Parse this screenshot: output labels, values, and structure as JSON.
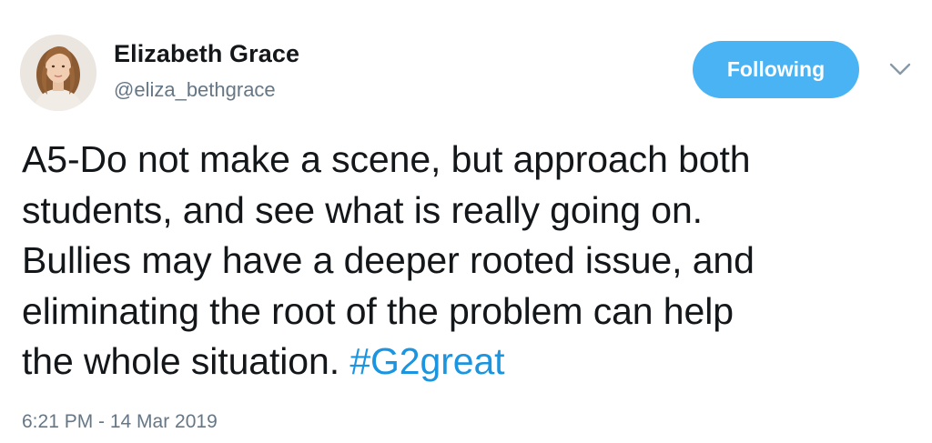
{
  "author": {
    "display_name": "Elizabeth Grace",
    "handle": "@eliza_bethgrace"
  },
  "follow_button": {
    "label": "Following",
    "color": "#4ab3f4"
  },
  "menu": {
    "icon": "chevron-down-icon"
  },
  "tweet": {
    "lines": [
      "A5-Do not make a scene, but approach both",
      "students, and see what is really going on.",
      "Bullies may have a deeper rooted issue, and",
      "eliminating the root of the problem can help",
      "the whole situation."
    ],
    "hashtag": "#G2great",
    "hashtag_color": "#1b95e0"
  },
  "timestamp": "6:21 PM - 14 Mar 2019"
}
